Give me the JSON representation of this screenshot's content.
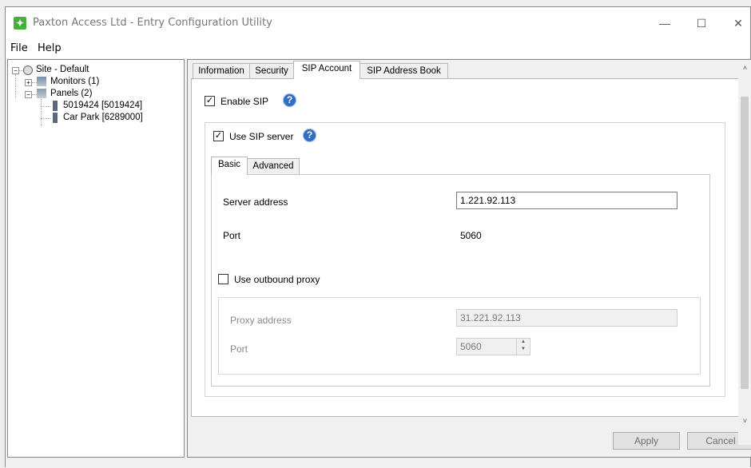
{
  "window": {
    "title": "Paxton Access Ltd - Entry Configuration Utility",
    "controls": {
      "minimize": "—",
      "maximize": "☐",
      "close": "✕"
    },
    "app_icon_color": "#46b13a"
  },
  "menu": {
    "items": [
      "File",
      "Help"
    ]
  },
  "tree": {
    "site": "Site - Default",
    "monitors": "Monitors (1)",
    "panels": "Panels (2)",
    "panel_items": [
      "5019424 [5019424]",
      "Car Park [6289000]"
    ]
  },
  "tabs": {
    "items": [
      "Information",
      "Security",
      "SIP Account",
      "SIP Address Book"
    ],
    "active": "SIP Account"
  },
  "sip": {
    "enable_label": "Enable SIP",
    "enable_checked": true,
    "use_server_label": "Use SIP server",
    "use_server_checked": true,
    "inner_tabs": [
      "Basic",
      "Advanced"
    ],
    "server_address_label": "Server address",
    "server_address_value": "1.221.92.113",
    "port_label": "Port",
    "port_value": "5060",
    "outbound_label": "Use outbound proxy",
    "outbound_checked": false,
    "proxy_address_label": "Proxy address",
    "proxy_address_value": "31.221.92.113",
    "proxy_port_label": "Port",
    "proxy_port_value": "5060"
  },
  "buttons": {
    "apply": "Apply",
    "cancel": "Cancel"
  },
  "colors": {
    "help_icon": "#2f6cc3",
    "checkmark": "#000000"
  }
}
